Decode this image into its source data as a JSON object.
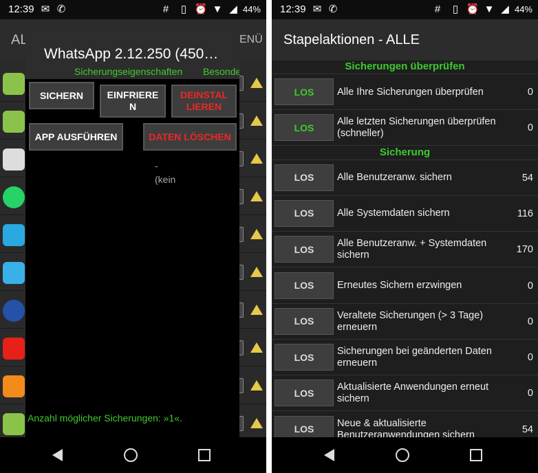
{
  "status": {
    "time": "12:39",
    "battery": "44%"
  },
  "left": {
    "bg_title": "AL",
    "bg_menu": "ENÜ",
    "dialog": {
      "title": "WhatsApp 2.12.250 (450…",
      "tab_properties": "Sicherungseigenschaften",
      "tab_special": "Besonde",
      "buttons": {
        "backup": "SICHERN",
        "freeze": "EINFRIERE\nN",
        "uninstall": "DEINSTAL\nLIEREN",
        "run": "APP AUSFÜHREN",
        "wipe": "DATEN LÖSCHEN"
      },
      "dash": "-",
      "none": "(kein",
      "count": "Anzahl möglicher Sicherungen: »1«."
    },
    "app_icons": [
      "android-icon",
      "android-icon",
      "dvd-icon",
      "whatsapp-icon",
      "lock-icon",
      "apps-icon",
      "compass-icon",
      "youtube-icon",
      "zdf-icon",
      "android-icon"
    ]
  },
  "right": {
    "title": "Stapelaktionen - ALLE",
    "sections": [
      {
        "header": "Sicherungen überprüfen",
        "rows": [
          {
            "button": "LOS",
            "label": "Alle Ihre Sicherungen überprüfen",
            "count": "0",
            "green": true
          },
          {
            "button": "LOS",
            "label": "Alle letzten Sicherungen überprüfen (schneller)",
            "count": "0",
            "green": true
          }
        ]
      },
      {
        "header": "Sicherung",
        "rows": [
          {
            "button": "LOS",
            "label": "Alle Benutzeranw. sichern",
            "count": "54"
          },
          {
            "button": "LOS",
            "label": "Alle Systemdaten sichern",
            "count": "116"
          },
          {
            "button": "LOS",
            "label": "Alle Benutzeranw. + Systemdaten sichern",
            "count": "170"
          },
          {
            "button": "LOS",
            "label": "Erneutes Sichern erzwingen",
            "count": "0"
          },
          {
            "button": "LOS",
            "label": "Veraltete Sicherungen (> 3 Tage) erneuern",
            "count": "0"
          },
          {
            "button": "LOS",
            "label": "Sicherungen bei geänderten Daten erneuern",
            "count": "0"
          },
          {
            "button": "LOS",
            "label": "Aktualisierte Anwendungen erneut sichern",
            "count": "0"
          },
          {
            "button": "LOS",
            "label": "Neue & aktualisierte Benutzeranwendungen sichern",
            "count": "54"
          }
        ]
      }
    ]
  },
  "colors": {
    "accent_green": "#3ecb2e",
    "danger_red": "#ee2727"
  }
}
